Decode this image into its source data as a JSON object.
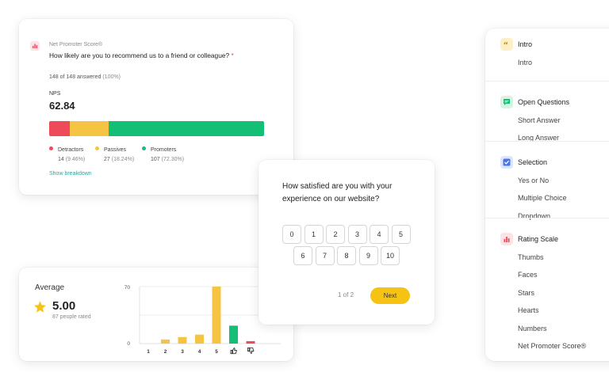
{
  "nps_card": {
    "label": "Net Promoter Score®",
    "question": "How likely are you to recommend us to a friend or colleague?",
    "required_mark": "*",
    "answered": "148 of 148 answered",
    "answered_pct": "(100%)",
    "metric_name": "NPS",
    "metric_value": "62.84",
    "colors": {
      "detractors": "#ef4a5a",
      "passives": "#f6c443",
      "promoters": "#12bf74",
      "link": "#2fa5a0"
    },
    "segments": [
      {
        "label": "Detractors",
        "count": "14",
        "pct": "(9.46%)",
        "fraction": 0.0946
      },
      {
        "label": "Passives",
        "count": "27",
        "pct": "(18.24%)",
        "fraction": 0.1824
      },
      {
        "label": "Promoters",
        "count": "107",
        "pct": "(72.30%)",
        "fraction": 0.723
      }
    ],
    "show_breakdown": "Show breakdown"
  },
  "rating_card": {
    "avg_label": "Average",
    "avg_value": "5.00",
    "avg_sub": "87 people rated",
    "star_icon": "star-icon",
    "chart_data": {
      "type": "bar",
      "categories": [
        "1",
        "2",
        "3",
        "4",
        "5",
        "thumbs-up-icon",
        "thumbs-down-icon"
      ],
      "category_labels": [
        "1",
        "2",
        "3",
        "4",
        "5",
        "",
        ""
      ],
      "values": [
        0,
        5,
        8,
        11,
        70,
        22,
        3
      ],
      "bar_colors": [
        "#f6c443",
        "#f6c443",
        "#f6c443",
        "#f6c443",
        "#f6c443",
        "#12bf74",
        "#ef4a5a"
      ],
      "ytick_labels": [
        "70",
        "0"
      ],
      "ylim": [
        0,
        70
      ],
      "grid": true
    }
  },
  "survey_card": {
    "question": "How satisfied are you with your experience on our website?",
    "row1": [
      "0",
      "1",
      "2",
      "3",
      "4",
      "5"
    ],
    "row2": [
      "6",
      "7",
      "8",
      "9",
      "10"
    ],
    "pager": "1 of 2",
    "next": "Next"
  },
  "types_card": {
    "groups": [
      {
        "key": "intro",
        "title": "Intro",
        "icon": "quote-icon",
        "icon_bg": "#fdf0c7",
        "icon_fg": "#c99400",
        "items": [
          "Intro"
        ]
      },
      {
        "key": "open",
        "title": "Open Questions",
        "icon": "chat-icon",
        "icon_bg": "#d8f3e5",
        "icon_fg": "#12bf74",
        "items": [
          "Short Answer",
          "Long Answer"
        ]
      },
      {
        "key": "selection",
        "title": "Selection",
        "icon": "checkbox-icon",
        "icon_bg": "#dde6fb",
        "icon_fg": "#4a74e8",
        "items": [
          "Yes or No",
          "Multiple Choice",
          "Dropdown"
        ]
      },
      {
        "key": "rating",
        "title": "Rating Scale",
        "icon": "bar-chart-icon",
        "icon_bg": "#fde3e6",
        "icon_fg": "#ef4a5a",
        "items": [
          "Thumbs",
          "Faces",
          "Stars",
          "Hearts",
          "Numbers",
          "Net Promoter Score®"
        ]
      }
    ]
  }
}
